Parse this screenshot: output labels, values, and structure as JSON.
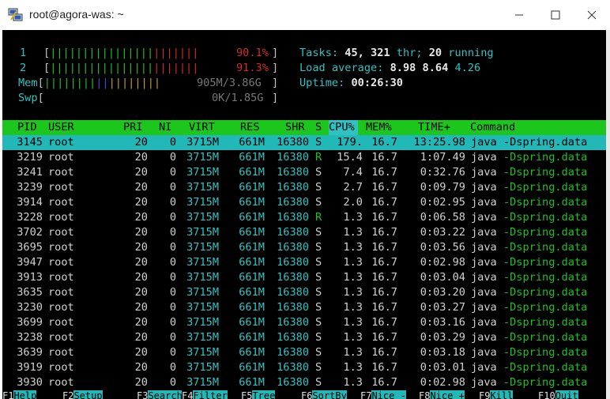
{
  "window": {
    "title": "root@agora-was: ~",
    "icon": "putty-icon",
    "controls": [
      "minimize",
      "maximize",
      "close"
    ]
  },
  "meters": {
    "cpu1": {
      "label": "1",
      "bars_green": "||||||||||||||||",
      "bars_red": "|||||||",
      "percent": "90.1%"
    },
    "cpu2": {
      "label": "2",
      "bars_green": "||||||||||||||||",
      "bars_red": "|||||||",
      "percent": "91.3%"
    },
    "mem": {
      "label": "Mem",
      "bars_green": "||||||||",
      "bars_blue": "||",
      "bars_yellow": "||||||||",
      "value": "905M/3.86G"
    },
    "swp": {
      "label": "Swp",
      "value": "0K/1.85G"
    }
  },
  "summary": {
    "tasks_label": "Tasks:",
    "tasks_value": "45,",
    "threads_value": "321",
    "threads_label": "thr;",
    "running_value": "20",
    "running_label": "running",
    "load_label": "Load average:",
    "load_1": "8.98",
    "load_5": "8.64",
    "load_15": "4.26",
    "uptime_label": "Uptime:",
    "uptime_value": "00:26:30"
  },
  "columns": [
    "PID",
    "USER",
    "PRI",
    "NI",
    "VIRT",
    "RES",
    "SHR",
    "S",
    "CPU%",
    "MEM%",
    "TIME+",
    "Command"
  ],
  "processes": [
    {
      "pid": "3145",
      "user": "root",
      "pri": "20",
      "ni": "0",
      "virt": "3715M",
      "res": "661M",
      "shr": "16380",
      "s": "S",
      "cpu": "179.",
      "mem": "16.7",
      "time": "13:25.98",
      "cmd": "java -Dspring.data"
    },
    {
      "pid": "3219",
      "user": "root",
      "pri": "20",
      "ni": "0",
      "virt": "3715M",
      "res": "661M",
      "shr": "16380",
      "s": "R",
      "cpu": "15.4",
      "mem": "16.7",
      "time": "1:07.49",
      "cmd": "java -Dspring.data"
    },
    {
      "pid": "3241",
      "user": "root",
      "pri": "20",
      "ni": "0",
      "virt": "3715M",
      "res": "661M",
      "shr": "16380",
      "s": "S",
      "cpu": "7.4",
      "mem": "16.7",
      "time": "0:32.76",
      "cmd": "java -Dspring.data"
    },
    {
      "pid": "3239",
      "user": "root",
      "pri": "20",
      "ni": "0",
      "virt": "3715M",
      "res": "661M",
      "shr": "16380",
      "s": "S",
      "cpu": "2.7",
      "mem": "16.7",
      "time": "0:09.79",
      "cmd": "java -Dspring.data"
    },
    {
      "pid": "3914",
      "user": "root",
      "pri": "20",
      "ni": "0",
      "virt": "3715M",
      "res": "661M",
      "shr": "16380",
      "s": "S",
      "cpu": "2.0",
      "mem": "16.7",
      "time": "0:02.95",
      "cmd": "java -Dspring.data"
    },
    {
      "pid": "3228",
      "user": "root",
      "pri": "20",
      "ni": "0",
      "virt": "3715M",
      "res": "661M",
      "shr": "16380",
      "s": "R",
      "cpu": "1.3",
      "mem": "16.7",
      "time": "0:06.58",
      "cmd": "java -Dspring.data"
    },
    {
      "pid": "3702",
      "user": "root",
      "pri": "20",
      "ni": "0",
      "virt": "3715M",
      "res": "661M",
      "shr": "16380",
      "s": "S",
      "cpu": "1.3",
      "mem": "16.7",
      "time": "0:03.22",
      "cmd": "java -Dspring.data"
    },
    {
      "pid": "3695",
      "user": "root",
      "pri": "20",
      "ni": "0",
      "virt": "3715M",
      "res": "661M",
      "shr": "16380",
      "s": "S",
      "cpu": "1.3",
      "mem": "16.7",
      "time": "0:03.56",
      "cmd": "java -Dspring.data"
    },
    {
      "pid": "3947",
      "user": "root",
      "pri": "20",
      "ni": "0",
      "virt": "3715M",
      "res": "661M",
      "shr": "16380",
      "s": "S",
      "cpu": "1.3",
      "mem": "16.7",
      "time": "0:02.98",
      "cmd": "java -Dspring.data"
    },
    {
      "pid": "3913",
      "user": "root",
      "pri": "20",
      "ni": "0",
      "virt": "3715M",
      "res": "661M",
      "shr": "16380",
      "s": "S",
      "cpu": "1.3",
      "mem": "16.7",
      "time": "0:03.04",
      "cmd": "java -Dspring.data"
    },
    {
      "pid": "3635",
      "user": "root",
      "pri": "20",
      "ni": "0",
      "virt": "3715M",
      "res": "661M",
      "shr": "16380",
      "s": "S",
      "cpu": "1.3",
      "mem": "16.7",
      "time": "0:03.20",
      "cmd": "java -Dspring.data"
    },
    {
      "pid": "3230",
      "user": "root",
      "pri": "20",
      "ni": "0",
      "virt": "3715M",
      "res": "661M",
      "shr": "16380",
      "s": "S",
      "cpu": "1.3",
      "mem": "16.7",
      "time": "0:03.27",
      "cmd": "java -Dspring.data"
    },
    {
      "pid": "3699",
      "user": "root",
      "pri": "20",
      "ni": "0",
      "virt": "3715M",
      "res": "661M",
      "shr": "16380",
      "s": "S",
      "cpu": "1.3",
      "mem": "16.7",
      "time": "0:03.16",
      "cmd": "java -Dspring.data"
    },
    {
      "pid": "3238",
      "user": "root",
      "pri": "20",
      "ni": "0",
      "virt": "3715M",
      "res": "661M",
      "shr": "16380",
      "s": "S",
      "cpu": "1.3",
      "mem": "16.7",
      "time": "0:03.29",
      "cmd": "java -Dspring.data"
    },
    {
      "pid": "3639",
      "user": "root",
      "pri": "20",
      "ni": "0",
      "virt": "3715M",
      "res": "661M",
      "shr": "16380",
      "s": "S",
      "cpu": "1.3",
      "mem": "16.7",
      "time": "0:03.18",
      "cmd": "java -Dspring.data"
    },
    {
      "pid": "3919",
      "user": "root",
      "pri": "20",
      "ni": "0",
      "virt": "3715M",
      "res": "661M",
      "shr": "16380",
      "s": "S",
      "cpu": "1.3",
      "mem": "16.7",
      "time": "0:03.01",
      "cmd": "java -Dspring.data"
    },
    {
      "pid": "3930",
      "user": "root",
      "pri": "20",
      "ni": "0",
      "virt": "3715M",
      "res": "661M",
      "shr": "16380",
      "s": "S",
      "cpu": "1.3",
      "mem": "16.7",
      "time": "0:02.98",
      "cmd": "java -Dspring.data"
    }
  ],
  "function_keys": [
    {
      "key": "F1",
      "label": "Help"
    },
    {
      "key": "F2",
      "label": "Setup"
    },
    {
      "key": "F3",
      "label": "Search"
    },
    {
      "key": "F4",
      "label": "Filter"
    },
    {
      "key": "F5",
      "label": "Tree"
    },
    {
      "key": "F6",
      "label": "SortBy"
    },
    {
      "key": "F7",
      "label": "Nice -"
    },
    {
      "key": "F8",
      "label": "Nice +"
    },
    {
      "key": "F9",
      "label": "Kill"
    },
    {
      "key": "F10",
      "label": "Quit"
    }
  ],
  "colors": {
    "terminal_bg": "#000000",
    "header_bg": "#1dc61d",
    "selected_bg": "#23b8b8",
    "cyan": "#30c2c2",
    "green": "#20c020",
    "red": "#d22a2a"
  }
}
